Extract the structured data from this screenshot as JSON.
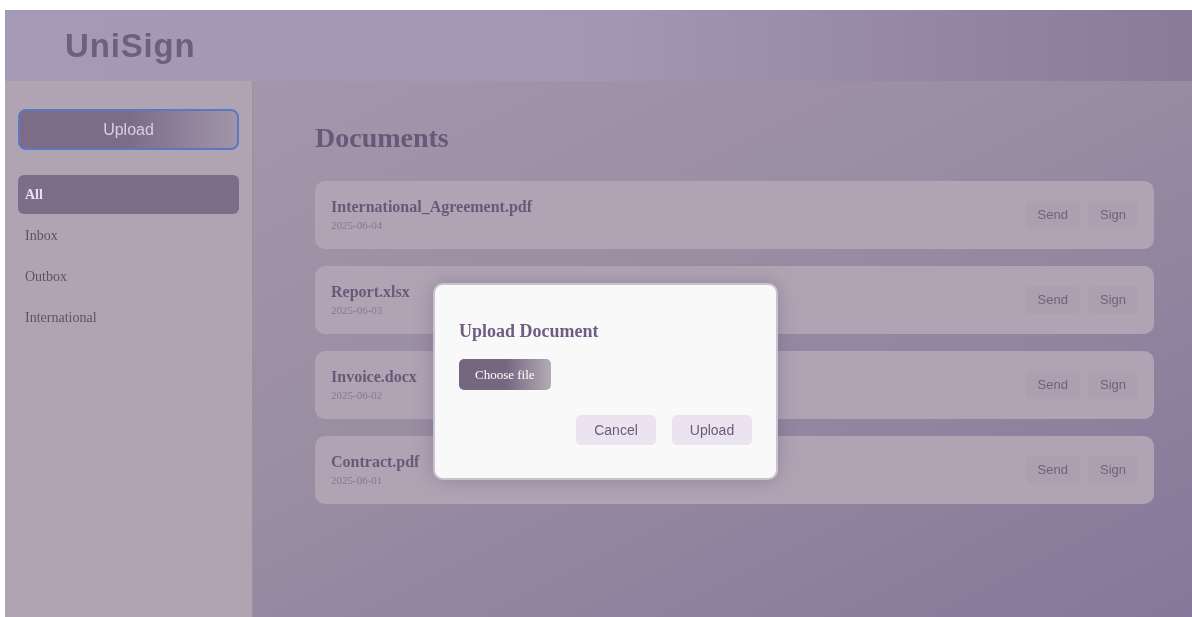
{
  "header": {
    "logo": "UniSign"
  },
  "sidebar": {
    "upload_button": "Upload",
    "items": [
      {
        "label": "All",
        "selected": true
      },
      {
        "label": "Inbox",
        "selected": false
      },
      {
        "label": "Outbox",
        "selected": false
      },
      {
        "label": "International",
        "selected": false
      }
    ]
  },
  "main": {
    "title": "Documents",
    "documents": [
      {
        "name": "International_Agreement.pdf",
        "date": "2025-06-04",
        "actions": [
          "Send",
          "Sign"
        ]
      },
      {
        "name": "Report.xlsx",
        "date": "2025-06-03",
        "actions": [
          "Send",
          "Sign"
        ]
      },
      {
        "name": "Invoice.docx",
        "date": "2025-06-02",
        "actions": [
          "Send",
          "Sign"
        ]
      },
      {
        "name": "Contract.pdf",
        "date": "2025-06-01",
        "actions": [
          "Send",
          "Sign"
        ]
      }
    ]
  },
  "dialog": {
    "title": "Upload Document",
    "file_button": "Choose file",
    "buttons": [
      "Cancel",
      "Upload"
    ]
  }
}
